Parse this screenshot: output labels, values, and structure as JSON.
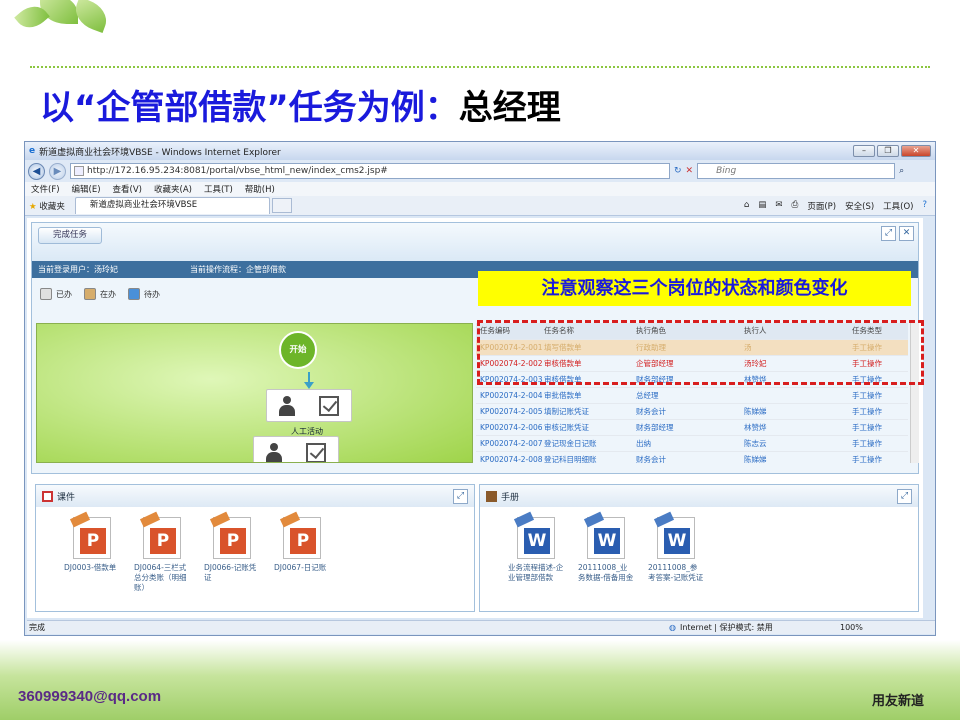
{
  "slide": {
    "title_part1": "以“企管部借款”任务为例：",
    "title_part2": "总经理",
    "email": "360999340@qq.com",
    "brand": "用友新道",
    "accent_color": "#1a1adc",
    "callout_bg": "#ffff00",
    "dash_color": "#d81e1e"
  },
  "window": {
    "title": "新道虚拟商业社会环境VBSE - Windows Internet Explorer",
    "url": "http://172.16.95.234:8081/portal/vbse_html_new/index_cms2.jsp#",
    "search_placeholder": "Bing",
    "menu": [
      "文件(F)",
      "编辑(E)",
      "查看(V)",
      "收藏夹(A)",
      "工具(T)",
      "帮助(H)"
    ],
    "favorites_label": "收藏夹",
    "tab_label": "新道虚拟商业社会环境VBSE",
    "command_items": [
      "页面(P)",
      "安全(S)",
      "工具(O)"
    ],
    "status_left": "完成",
    "status_zone": "Internet | 保护模式: 禁用",
    "zoom": "100%"
  },
  "app": {
    "done_button": "完成任务",
    "current_user": "当前登录用户：汤玲妃",
    "current_flow": "当前操作流程：企管部借款",
    "legend": [
      {
        "label": "已办",
        "color": "#e0e0e0"
      },
      {
        "label": "在办",
        "color": "#d6ad6c"
      },
      {
        "label": "待办",
        "color": "#4a90d9"
      }
    ],
    "flow_start": "开始",
    "flow_node_label": "人工活动",
    "callout": "注意观察这三个岗位的状态和颜色变化",
    "table_headers": [
      "任务编码",
      "任务名称",
      "执行角色",
      "执行人",
      "任务类型"
    ],
    "table_rows": [
      {
        "code": "KP002074-2-001",
        "name": "填写借款单",
        "role": "行政助理",
        "user": "汤",
        "type": "手工操作",
        "color": "#d6ad6c"
      },
      {
        "code": "KP002074-2-002",
        "name": "审核借款单",
        "role": "企管部经理",
        "user": "汤玲妃",
        "type": "手工操作",
        "color": "#d21f1f"
      },
      {
        "code": "KP002074-2-003",
        "name": "审核借款单",
        "role": "财务部经理",
        "user": "林赞烨",
        "type": "手工操作",
        "color": "#2b6cc4"
      },
      {
        "code": "KP002074-2-004",
        "name": "审批借款单",
        "role": "总经理",
        "user": "",
        "type": "手工操作",
        "color": "#2b6cc4"
      },
      {
        "code": "KP002074-2-005",
        "name": "填制记账凭证",
        "role": "财务会计",
        "user": "陈娣娣",
        "type": "手工操作",
        "color": "#2b6cc4"
      },
      {
        "code": "KP002074-2-006",
        "name": "审核记账凭证",
        "role": "财务部经理",
        "user": "林赞烨",
        "type": "手工操作",
        "color": "#2b6cc4"
      },
      {
        "code": "KP002074-2-007",
        "name": "登记现金日记账",
        "role": "出纳",
        "user": "陈志云",
        "type": "手工操作",
        "color": "#2b6cc4"
      },
      {
        "code": "KP002074-2-008",
        "name": "登记科目明细账",
        "role": "财务会计",
        "user": "陈娣娣",
        "type": "手工操作",
        "color": "#2b6cc4"
      }
    ],
    "courseware_title": "课件",
    "courseware": [
      {
        "label": "DJ0003-借款单",
        "icon": "ppt-icon"
      },
      {
        "label": "DJ0064-三栏式总分类账（明细账）",
        "icon": "ppt-icon"
      },
      {
        "label": "DJ0066-记账凭证",
        "icon": "ppt-icon"
      },
      {
        "label": "DJ0067-日记账",
        "icon": "ppt-icon"
      }
    ],
    "manual_title": "手册",
    "manuals": [
      {
        "label": "业务流程描述-企业管理部借款",
        "icon": "word-icon"
      },
      {
        "label": "20111008_业务数据-借备用金",
        "icon": "word-icon"
      },
      {
        "label": "20111008_参考答案-记账凭证",
        "icon": "word-icon"
      }
    ]
  }
}
